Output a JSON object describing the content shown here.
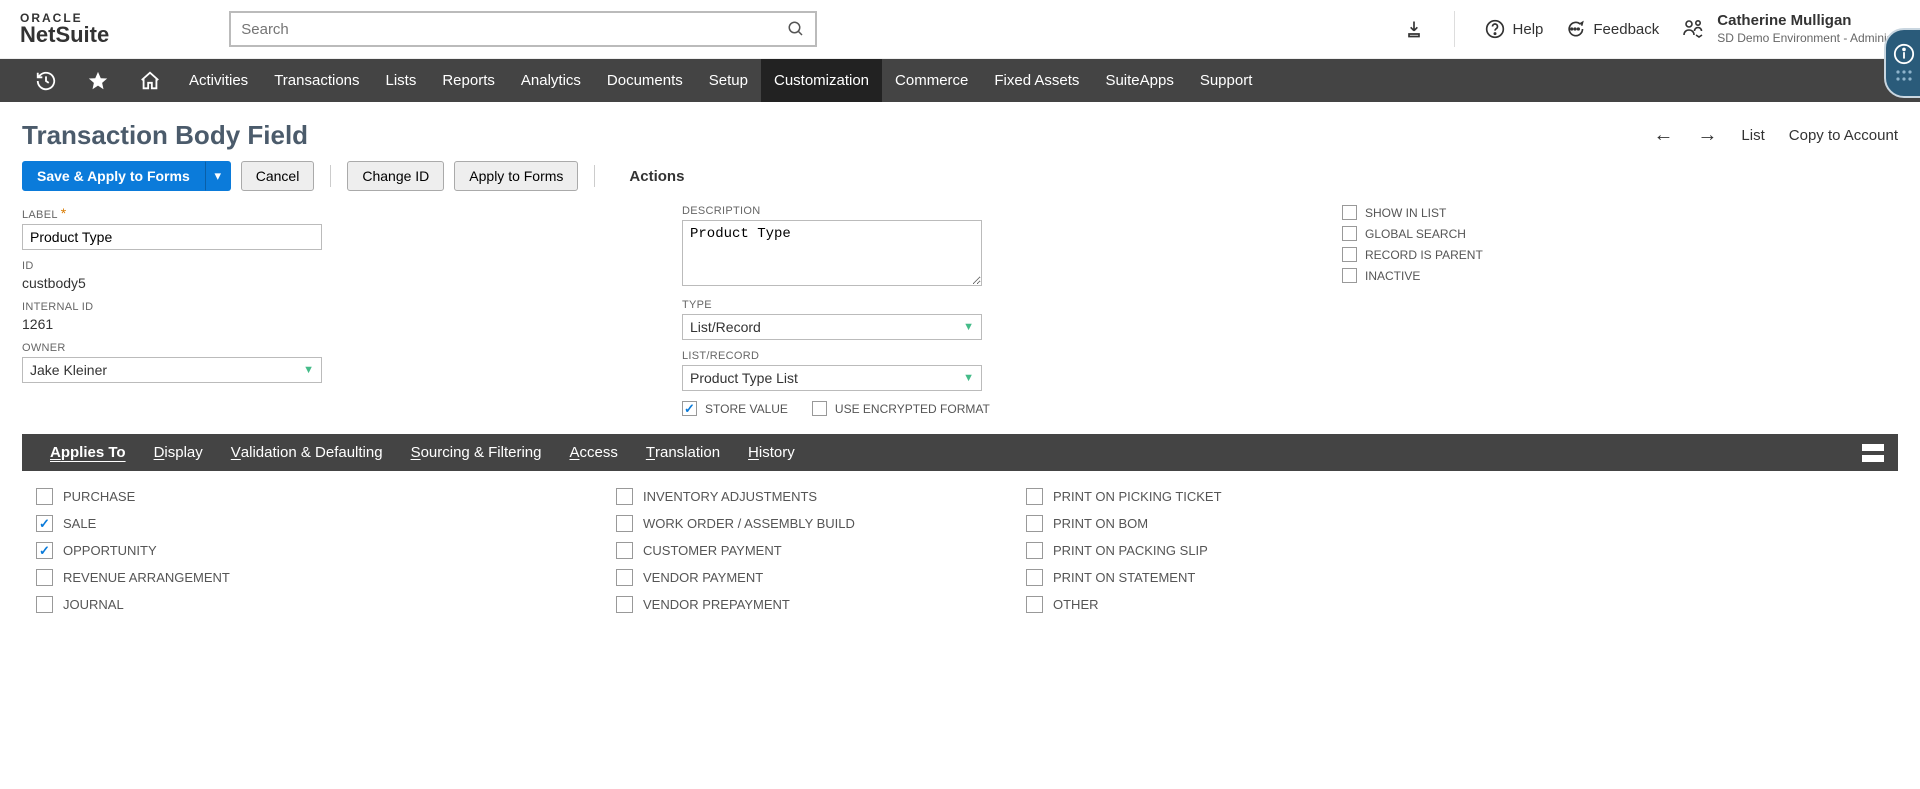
{
  "header": {
    "logo_top": "ORACLE",
    "logo_bottom": "NetSuite",
    "search_placeholder": "Search",
    "help": "Help",
    "feedback": "Feedback",
    "user_name": "Catherine Mulligan",
    "user_role": "SD Demo Environment - Administr"
  },
  "nav": {
    "items": [
      "Activities",
      "Transactions",
      "Lists",
      "Reports",
      "Analytics",
      "Documents",
      "Setup",
      "Customization",
      "Commerce",
      "Fixed Assets",
      "SuiteApps",
      "Support"
    ],
    "active": "Customization"
  },
  "page": {
    "title": "Transaction Body Field",
    "list_link": "List",
    "copy_link": "Copy to Account"
  },
  "buttons": {
    "save_apply": "Save & Apply to Forms",
    "cancel": "Cancel",
    "change_id": "Change ID",
    "apply_to_forms": "Apply to Forms",
    "actions": "Actions"
  },
  "fields": {
    "label_label": "LABEL",
    "label_value": "Product Type",
    "id_label": "ID",
    "id_value": "custbody5",
    "internal_id_label": "INTERNAL ID",
    "internal_id_value": "1261",
    "owner_label": "OWNER",
    "owner_value": "Jake Kleiner",
    "description_label": "DESCRIPTION",
    "description_value": "Product Type",
    "type_label": "TYPE",
    "type_value": "List/Record",
    "listrecord_label": "LIST/RECORD",
    "listrecord_value": "Product Type List",
    "store_value_label": "STORE VALUE",
    "encrypted_label": "USE ENCRYPTED FORMAT",
    "show_in_list": "SHOW IN LIST",
    "global_search": "GLOBAL SEARCH",
    "record_is_parent": "RECORD IS PARENT",
    "inactive": "INACTIVE"
  },
  "tabs": [
    "Applies To",
    "Display",
    "Validation & Defaulting",
    "Sourcing & Filtering",
    "Access",
    "Translation",
    "History"
  ],
  "applies": {
    "col1": [
      {
        "label": "PURCHASE",
        "checked": false
      },
      {
        "label": "SALE",
        "checked": true
      },
      {
        "label": "OPPORTUNITY",
        "checked": true
      },
      {
        "label": "REVENUE ARRANGEMENT",
        "checked": false
      },
      {
        "label": "JOURNAL",
        "checked": false
      }
    ],
    "col2": [
      {
        "label": "INVENTORY ADJUSTMENTS",
        "checked": false
      },
      {
        "label": "WORK ORDER / ASSEMBLY BUILD",
        "checked": false
      },
      {
        "label": "CUSTOMER PAYMENT",
        "checked": false
      },
      {
        "label": "VENDOR PAYMENT",
        "checked": false
      },
      {
        "label": "VENDOR PREPAYMENT",
        "checked": false
      }
    ],
    "col3": [
      {
        "label": "PRINT ON PICKING TICKET",
        "checked": false
      },
      {
        "label": "PRINT ON BOM",
        "checked": false
      },
      {
        "label": "PRINT ON PACKING SLIP",
        "checked": false
      },
      {
        "label": "PRINT ON STATEMENT",
        "checked": false
      },
      {
        "label": "OTHER",
        "checked": false
      }
    ]
  }
}
